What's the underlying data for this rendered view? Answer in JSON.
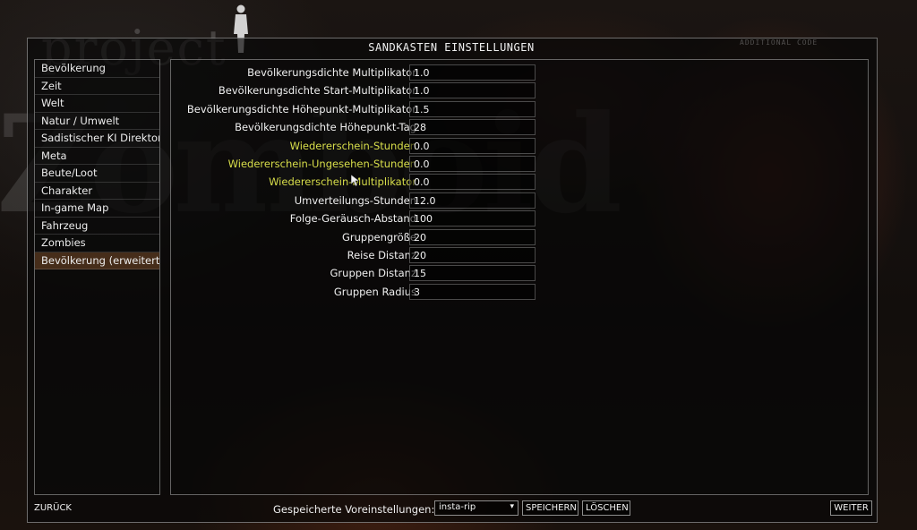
{
  "background": {
    "logo_line1": "project",
    "logo_line2": "Zomboid"
  },
  "header": {
    "title": "SANDKASTEN EINSTELLUNGEN",
    "additional_code": "ADDITIONAL CODE"
  },
  "sidebar": {
    "items": [
      {
        "label": "Bevölkerung"
      },
      {
        "label": "Zeit"
      },
      {
        "label": "Welt"
      },
      {
        "label": "Natur / Umwelt"
      },
      {
        "label": "Sadistischer KI Direktor"
      },
      {
        "label": "Meta"
      },
      {
        "label": "Beute/Loot"
      },
      {
        "label": "Charakter"
      },
      {
        "label": "In-game Map"
      },
      {
        "label": "Fahrzeug"
      },
      {
        "label": "Zombies"
      },
      {
        "label": "Bevölkerung (erweitert)"
      }
    ],
    "active_index": 11
  },
  "settings": [
    {
      "label": "Bevölkerungsdichte Multiplikator",
      "value": "1.0",
      "highlight": false
    },
    {
      "label": "Bevölkerungsdichte Start-Multiplikator",
      "value": "1.0",
      "highlight": false
    },
    {
      "label": "Bevölkerungsdichte Höhepunkt-Multiplikator",
      "value": "1.5",
      "highlight": false
    },
    {
      "label": "Bevölkerungsdichte Höhepunkt-Tag",
      "value": "28",
      "highlight": false
    },
    {
      "label": "Wiedererschein-Stunden",
      "value": "0.0",
      "highlight": true
    },
    {
      "label": "Wiedererschein-Ungesehen-Stunden",
      "value": "0.0",
      "highlight": true
    },
    {
      "label": "Wiedererschein-Multiplikator",
      "value": "0.0",
      "highlight": true
    },
    {
      "label": "Umverteilungs-Stunden",
      "value": "12.0",
      "highlight": false
    },
    {
      "label": "Folge-Geräusch-Abstand",
      "value": "100",
      "highlight": false
    },
    {
      "label": "Gruppengröße",
      "value": "20",
      "highlight": false
    },
    {
      "label": "Reise Distanz",
      "value": "20",
      "highlight": false
    },
    {
      "label": "Gruppen Distanz",
      "value": "15",
      "highlight": false
    },
    {
      "label": "Gruppen Radius",
      "value": "3",
      "highlight": false
    }
  ],
  "footer": {
    "back_label": "ZURÜCK",
    "presets_label": "Gespeicherte Voreinstellungen:",
    "preset_selected": "insta-rip",
    "save_label": "SPEICHERN",
    "delete_label": "LÖSCHEN",
    "next_label": "WEITER"
  },
  "colors": {
    "highlight": "#d8de4a",
    "active_item": "#784b28"
  },
  "icons": {
    "select_arrow": "chevron-down-icon",
    "pointer": "mouse-cursor-icon"
  }
}
